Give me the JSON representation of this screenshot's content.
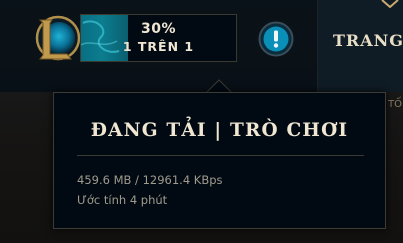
{
  "download": {
    "progress_text": "30%",
    "progress_fraction": 0.3,
    "queue_text": "1 TRÊN 1"
  },
  "nav": {
    "label": "TRANG"
  },
  "edge_glimpse": "TỐ",
  "tooltip": {
    "title": "ĐANG TẢI | TRÒ CHƠI",
    "speed_text": "459.6 MB / 12961.4 KBps",
    "eta_text": "Ước tính 4 phút"
  },
  "icons": {
    "logo": "league-logo-icon",
    "alert": "alert-icon",
    "chevron": "chevron-down-icon"
  },
  "colors": {
    "accent_gold": "#c8aa6e",
    "progress_teal": "#0b7d8f",
    "alert_blue": "#0a8fb8",
    "text_light": "#f0e6d2"
  }
}
